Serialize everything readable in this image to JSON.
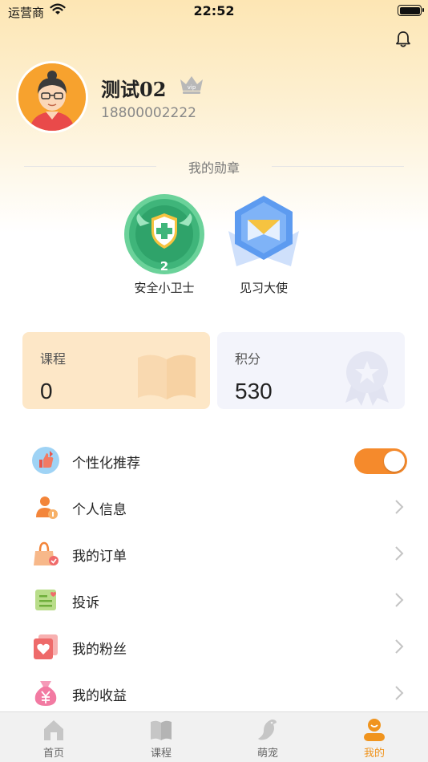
{
  "status_bar": {
    "carrier": "运营商",
    "time": "22:52"
  },
  "profile": {
    "name": "测试02",
    "phone": "18800002222",
    "vip": "vip"
  },
  "medals": {
    "title": "我的勋章",
    "items": [
      {
        "label": "安全小卫士",
        "level": "2"
      },
      {
        "label": "见习大使"
      }
    ]
  },
  "stats": {
    "course": {
      "label": "课程",
      "value": "0"
    },
    "points": {
      "label": "积分",
      "value": "530"
    }
  },
  "menu": {
    "personalized": {
      "label": "个性化推荐",
      "enabled": true
    },
    "items": [
      {
        "label": "个人信息"
      },
      {
        "label": "我的订单"
      },
      {
        "label": "投诉"
      },
      {
        "label": "我的粉丝"
      },
      {
        "label": "我的收益"
      }
    ]
  },
  "tabbar": {
    "tabs": [
      {
        "label": "首页"
      },
      {
        "label": "课程"
      },
      {
        "label": "萌宠"
      },
      {
        "label": "我的"
      }
    ],
    "active_index": 3
  },
  "colors": {
    "accent": "#f58a2c",
    "active_tab": "#f0941e",
    "card_course": "#fde7c7",
    "card_points": "#f3f4fb"
  }
}
